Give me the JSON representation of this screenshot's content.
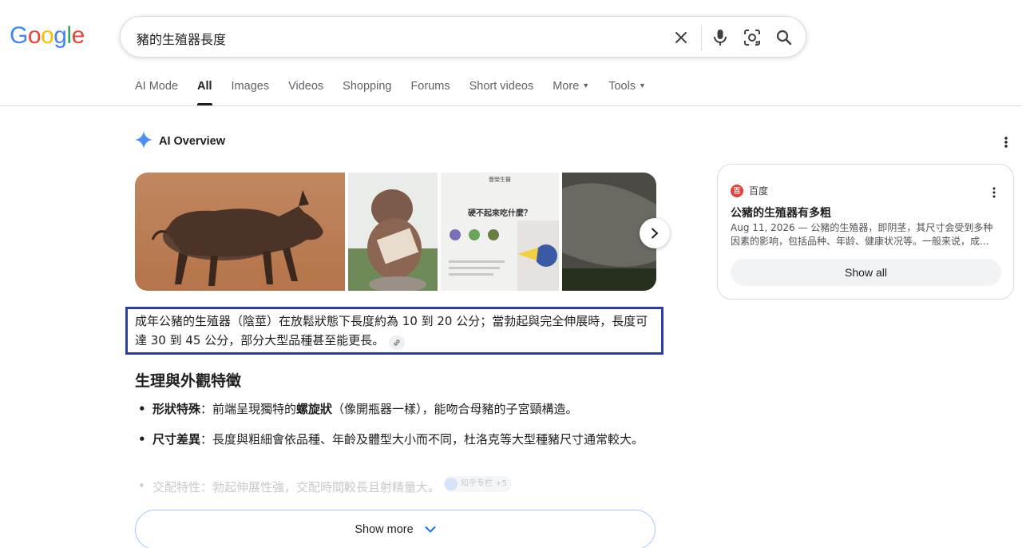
{
  "logo": {
    "letters": [
      "G",
      "o",
      "o",
      "g",
      "l",
      "e"
    ],
    "colors": [
      "#4285F4",
      "#EA4335",
      "#FBBC05",
      "#4285F4",
      "#34A853",
      "#EA4335"
    ]
  },
  "search": {
    "query": "豬的生殖器長度"
  },
  "icons": {
    "clear": "close-icon",
    "voice": "microphone-icon",
    "lens": "camera-lens-icon",
    "search": "search-icon"
  },
  "tabs": [
    {
      "label": "AI Mode"
    },
    {
      "label": "All",
      "active": true
    },
    {
      "label": "Images"
    },
    {
      "label": "Videos"
    },
    {
      "label": "Shopping"
    },
    {
      "label": "Forums"
    },
    {
      "label": "Short videos"
    },
    {
      "label": "More",
      "dropdown": true
    },
    {
      "label": "Tools",
      "dropdown": true
    }
  ],
  "ai_overview": {
    "title": "AI Overview",
    "summary": "成年公豬的生殖器（陰莖）在放鬆狀態下長度約為 10 到 20 公分；當勃起與完全伸展時，長度可達 30 到 45 公分，部分大型品種甚至能更長。",
    "section_heading": "生理與外觀特徵",
    "bullets": [
      {
        "term": "形狀特殊",
        "pre": "：前端呈現獨特的",
        "bold": "螺旋狀",
        "post": "（像開瓶器一樣），能吻合母豬的子宮頸構造。"
      },
      {
        "term": "尺寸差異",
        "pre": "：長度與粗細會依品種、年齡及體型大小而不同，杜洛克等大型種豬尺寸通常較大。",
        "bold": "",
        "post": ""
      }
    ],
    "faded_bullet": {
      "term": "交配特性",
      "text": "：勃起伸展性強，交配時間較長且射精量大。",
      "chip": "知乎专栏 +5"
    },
    "image3_text": {
      "brand": "豐榮生醫",
      "heading": "硬不起來吃什麼？"
    },
    "show_more": "Show more"
  },
  "side_card": {
    "source": "百度",
    "title": "公豬的生殖器有多粗",
    "snippet": "Aug 11, 2026 — 公豬的生殖器，即阴茎，其尺寸会受到多种因素的影响，包括品种、年龄、健康状况等。一般来说，成...",
    "show_all": "Show all"
  },
  "colors": {
    "highlight_border": "#2b3ea8",
    "accent_blue": "#1a73e8",
    "favicon_red": "#e8403a"
  }
}
